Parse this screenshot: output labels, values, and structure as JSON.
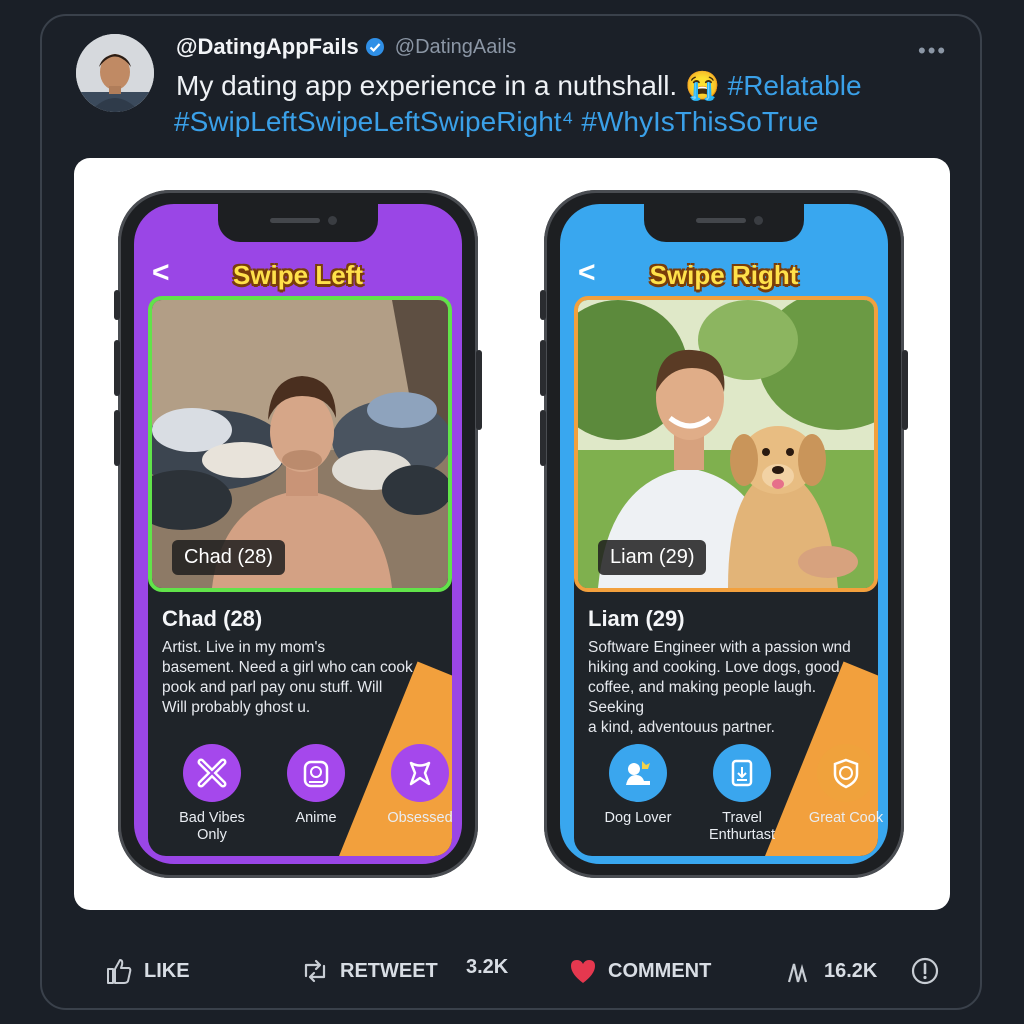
{
  "tweet": {
    "display_name": "@DatingAppFails",
    "username": "@DatingAails",
    "text_part1": "My dating app experience in a nuthshall. 😭 ",
    "text_tag1": "#Relatable",
    "text_line2": "#SwipLeftSwipeLeftSwipeRight⁴ #WhyIsThisSoTrue",
    "more_label": "•••"
  },
  "left_phone": {
    "title": "Swipe Left",
    "back_label": "<",
    "photo_name": "Chad (28)",
    "profile_name": "Chad (28)",
    "bio": "Artist. Live in my mom's\nbasement. Need a girl who can cook\npook and parl pay onu stuff. Will\nWill probably ghost u.",
    "badges": [
      {
        "label": "Bad Vibes\nOnly",
        "icon": "cross-icon"
      },
      {
        "label": "Anime",
        "icon": "tv-icon"
      },
      {
        "label": "Obsessed",
        "icon": "ribbon-icon"
      }
    ],
    "theme_color": "#9a46e6",
    "photo_border": "#61e34a"
  },
  "right_phone": {
    "title": "Swipe Right",
    "back_label": "<",
    "photo_name": "Liam (29)",
    "profile_name": "Liam (29)",
    "bio": "Software Engineer with a passion wnd\nhiking and cooking. Love dogs, good\ncoffee, and making people laugh. Seeking\na kind, adventouus partner.",
    "badges": [
      {
        "label": "Dog Lover",
        "icon": "dog-icon"
      },
      {
        "label": "Travel\nEnthurtast",
        "icon": "suitcase-icon"
      },
      {
        "label": "Great Cook",
        "icon": "chef-badge-icon"
      }
    ],
    "theme_color": "#39a7ef",
    "photo_border": "#f2a03d"
  },
  "actions": {
    "like_label": "LIKE",
    "retweet_label": "RETWEET",
    "retweet_count": "3.2K",
    "comment_label": "COMMENT",
    "views_count": "16.2K"
  }
}
